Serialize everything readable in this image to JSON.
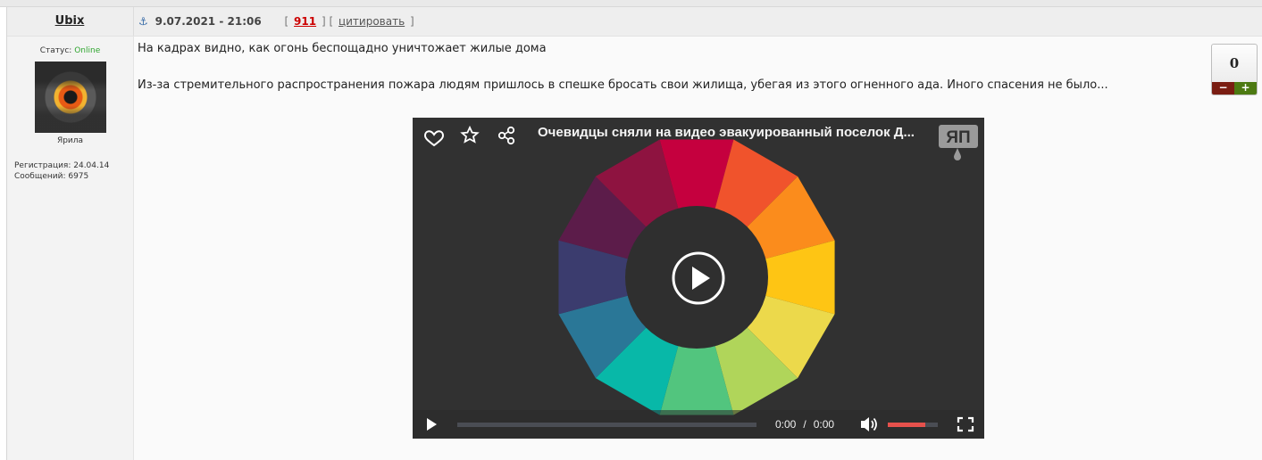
{
  "post": {
    "author": "Ubix",
    "date": "9.07.2021 - 21:06",
    "post_number": "911",
    "quote_label": "цитировать",
    "bracket_open": "[",
    "bracket_close": "]"
  },
  "user": {
    "status_label": "Статус:",
    "status_value": "Online",
    "rank": "Ярила",
    "registration": "Регистрация: 24.04.14",
    "messages": "Сообщений: 6975"
  },
  "content": {
    "paragraph1": "На кадрах видно, как огонь беспощадно уничтожает жилые дома",
    "paragraph2": "Из-за стремительного распространения пожара людям пришлось в спешке бросать свои жилища, убегая из этого огненного ада. Иного спасения не было..."
  },
  "rating": {
    "value": "0",
    "minus": "−",
    "plus": "+"
  },
  "video": {
    "title": "Очевидцы сняли на видео эвакуированный поселок Д...",
    "current_time": "0:00",
    "separator": "/",
    "duration": "0:00",
    "progress": 0,
    "volume": 0.75,
    "logo_text": "ЯП",
    "wheel_colors": [
      "#c5003e",
      "#f0532c",
      "#fb8c1c",
      "#fec514",
      "#ecd94b",
      "#b0d55a",
      "#52c57e",
      "#08b8a8",
      "#2a7797",
      "#3b3c6e",
      "#5c1c4a",
      "#8e1340"
    ],
    "accent_color": "#e6514c",
    "icons": [
      "heart-icon",
      "star-icon",
      "share-icon",
      "play-icon",
      "volume-icon",
      "fullscreen-icon"
    ]
  }
}
